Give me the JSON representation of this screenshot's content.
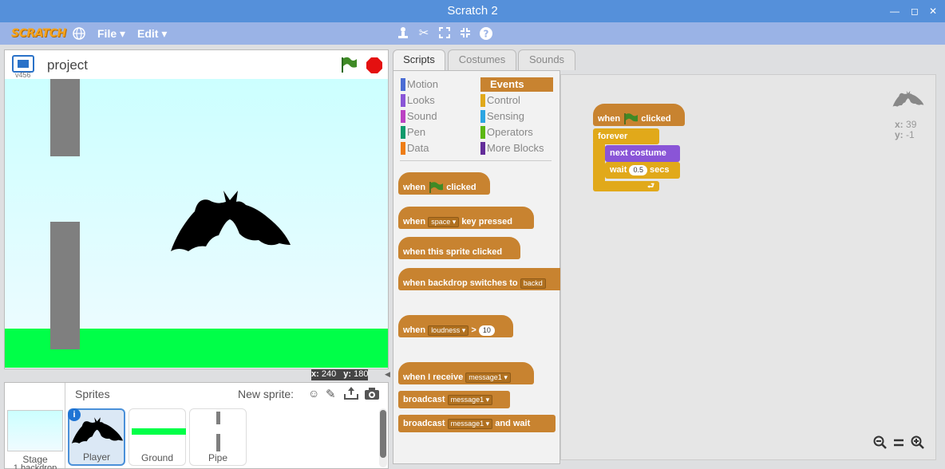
{
  "window": {
    "title": "Scratch 2",
    "minimize": "—",
    "maximize": "◻",
    "close": "✕"
  },
  "menu": {
    "logo": "SCRATCH",
    "file": "File ▾",
    "edit": "Edit ▾"
  },
  "stage": {
    "version": "v456",
    "project_name": "project",
    "x_label": "x:",
    "x_value": "240",
    "y_label": "y:",
    "y_value": "180"
  },
  "sprites_panel": {
    "stage_label": "Stage",
    "stage_sub": "1 backdrop",
    "title": "Sprites",
    "new_sprite": "New sprite:"
  },
  "sprites": [
    {
      "label": "Player"
    },
    {
      "label": "Ground"
    },
    {
      "label": "Pipe"
    }
  ],
  "tabs": {
    "scripts": "Scripts",
    "costumes": "Costumes",
    "sounds": "Sounds"
  },
  "categories": [
    {
      "label": "Motion",
      "color": "#4a6cd4"
    },
    {
      "label": "Looks",
      "color": "#8a55d7"
    },
    {
      "label": "Sound",
      "color": "#bb42c3"
    },
    {
      "label": "Pen",
      "color": "#0e9a6c"
    },
    {
      "label": "Data",
      "color": "#ee7d16"
    },
    {
      "label": "Events",
      "color": "#c88330"
    },
    {
      "label": "Control",
      "color": "#e1a91a"
    },
    {
      "label": "Sensing",
      "color": "#2ca5e2"
    },
    {
      "label": "Operators",
      "color": "#5cb712"
    },
    {
      "label": "More Blocks",
      "color": "#632d99"
    }
  ],
  "palette_blocks": {
    "b1_when": "when",
    "b1_clicked": "clicked",
    "b2_when": "when",
    "b2_key": "space",
    "b2_rest": "key pressed",
    "b3": "when this sprite clicked",
    "b4": "when backdrop switches to",
    "b4_dd": "backd",
    "b5_when": "when",
    "b5_dd": "loudness",
    "b5_gt": ">",
    "b5_num": "10",
    "b6": "when I receive",
    "b6_dd": "message1",
    "b7": "broadcast",
    "b7_dd": "message1",
    "b8": "broadcast",
    "b8_dd": "message1",
    "b8_rest": "and wait"
  },
  "script": {
    "hat_when": "when",
    "hat_clicked": "clicked",
    "forever": "forever",
    "next_costume": "next costume",
    "wait": "wait",
    "wait_num": "0.5",
    "secs": "secs"
  },
  "sprite_info": {
    "x_label": "x:",
    "x": "39",
    "y_label": "y:",
    "y": "-1"
  }
}
